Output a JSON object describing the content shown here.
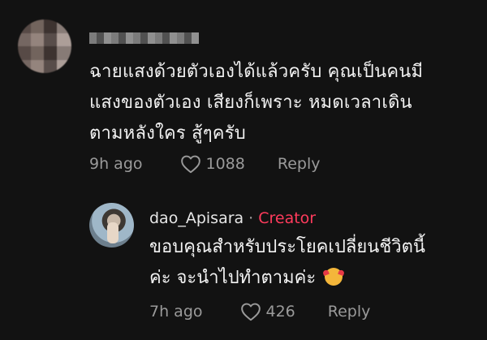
{
  "comment": {
    "text_line1": "ฉายแสงด้วยตัวเองได้แล้วครับ คุณเป็นคนมี",
    "text_line2": "แสงของตัวเอง เสียงก็เพราะ หมดเวลาเดิน",
    "text_line3": "ตามหลังใคร สู้ๆครับ",
    "time": "9h ago",
    "likes": "1088",
    "reply_label": "Reply"
  },
  "reply": {
    "username": "dao_Apisara",
    "separator": "·",
    "badge": "Creator",
    "text_line1": "ขอบคุณสำหรับประโยคเปลี่ยนชีวิตนี้",
    "text_line2": "ค่ะ จะนำไปทำตามค่ะ",
    "emoji_icon": "smiling-face-with-hearts",
    "time": "7h ago",
    "likes": "426",
    "reply_label": "Reply"
  },
  "colors": {
    "background": "#121212",
    "creator_accent": "#ff3b5c",
    "meta_gray": "#9a9a9a"
  }
}
